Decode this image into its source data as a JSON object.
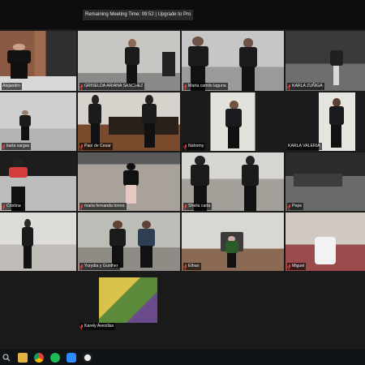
{
  "meeting_banner": "Remaining Meeting Time: 09:52 | Upgrade to Pro",
  "participants": [
    {
      "name": "Alejandro",
      "active_speaker": true,
      "muted": false
    },
    {
      "name": "GRISELDA ARIANA SANCHEZ",
      "active_speaker": false,
      "muted": true
    },
    {
      "name": "Marta camilo laguna",
      "active_speaker": false,
      "muted": true
    },
    {
      "name": "KARLA ZUÑIGA",
      "active_speaker": false,
      "muted": true
    },
    {
      "name": "karla vargas",
      "active_speaker": false,
      "muted": true
    },
    {
      "name": "Paul de Cesar",
      "active_speaker": false,
      "muted": true
    },
    {
      "name": "Nahomy",
      "active_speaker": false,
      "muted": true
    },
    {
      "name": "KARLA VALERIA",
      "active_speaker": false,
      "muted": false
    },
    {
      "name": "Cristina",
      "active_speaker": false,
      "muted": true
    },
    {
      "name": "maria fernanda torres",
      "active_speaker": false,
      "muted": true
    },
    {
      "name": "Sheila carla",
      "active_speaker": false,
      "muted": true
    },
    {
      "name": "Pepe",
      "active_speaker": false,
      "muted": true
    },
    {
      "name": "",
      "active_speaker": false,
      "muted": false
    },
    {
      "name": "Yurydia y Gunther",
      "active_speaker": false,
      "muted": true
    },
    {
      "name": "Ethan",
      "active_speaker": false,
      "muted": true
    },
    {
      "name": "Miguel",
      "active_speaker": false,
      "muted": true
    },
    {
      "name": "Karely Avecillas",
      "active_speaker": false,
      "muted": true
    }
  ],
  "taskbar_icons": [
    "search-icon",
    "file-explorer-icon",
    "chrome-icon",
    "spotify-icon",
    "zoom-icon",
    "obs-icon"
  ],
  "colors": {
    "active_border": "#b7e04a",
    "muted_mic": "#e0443b",
    "background": "#1a1a1a"
  }
}
